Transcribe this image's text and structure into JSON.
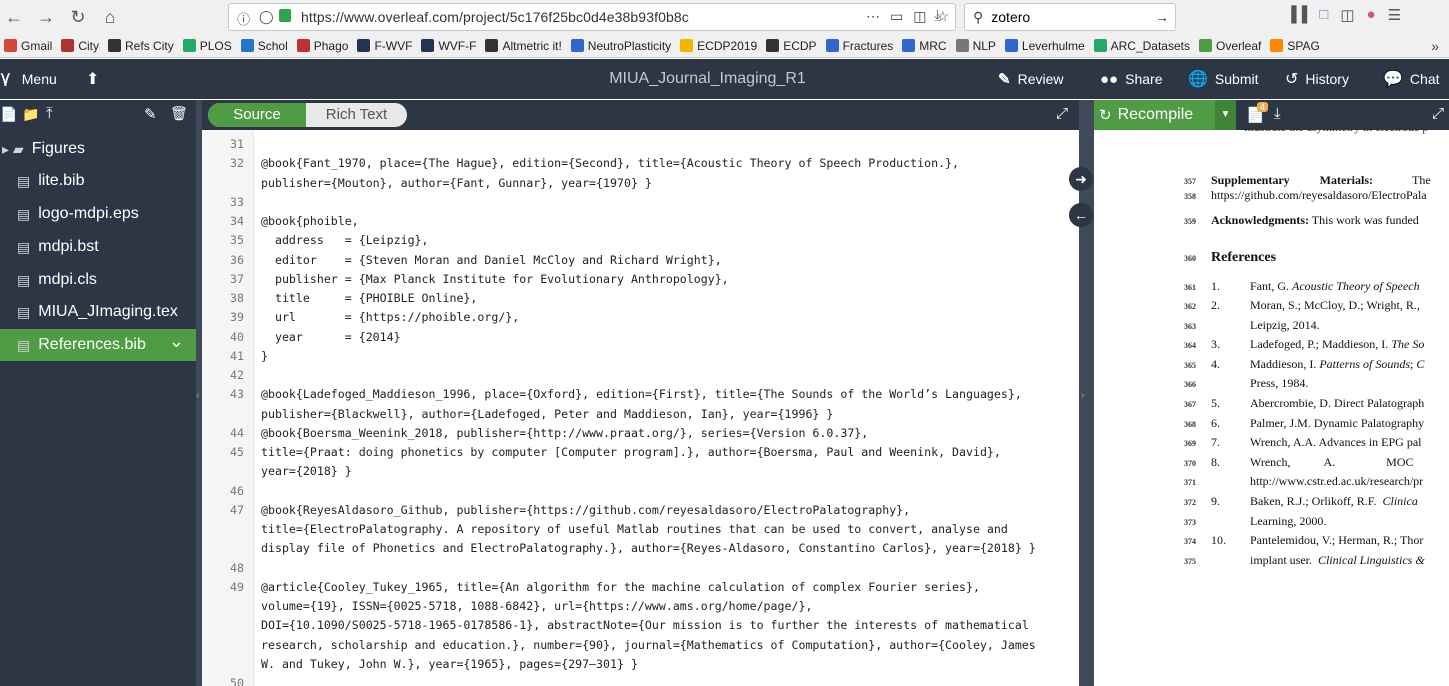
{
  "browser": {
    "url": "https://www.overleaf.com/project/5c176f25bc0d4e38b93f0b8c",
    "search": "zotero",
    "bookmarks": [
      "Gmail",
      "City",
      "Refs City",
      "PLOS",
      "Schol",
      "Phago",
      "F-WVF",
      "WVF-F",
      "Altmetric it!",
      "NeutroPlasticity",
      "ECDP2019",
      "ECDP",
      "Fractures",
      "MRC",
      "NLP",
      "Leverhulme",
      "ARC_Datasets",
      "Overleaf",
      "SPAG"
    ]
  },
  "header": {
    "menu": "Menu",
    "project_title": "MIUA_Journal_Imaging_R1",
    "review": "Review",
    "share": "Share",
    "submit": "Submit",
    "history": "History",
    "chat": "Chat"
  },
  "editor": {
    "source": "Source",
    "rich_text": "Rich Text",
    "recompile": "Recompile",
    "log_badge": "4"
  },
  "files": [
    "Figures",
    "lite.bib",
    "logo-mdpi.eps",
    "mdpi.bst",
    "mdpi.cls",
    "MIUA_JImaging.tex",
    "References.bib"
  ],
  "code": [
    {
      "n": "31",
      "t": ""
    },
    {
      "n": "32",
      "t": "@book{Fant_1970, place={The Hague}, edition={Second}, title={Acoustic Theory of Speech Production.},"
    },
    {
      "n": "",
      "t": "publisher={Mouton}, author={Fant, Gunnar}, year={1970} }"
    },
    {
      "n": "33",
      "t": ""
    },
    {
      "n": "34",
      "t": "@book{phoible,"
    },
    {
      "n": "35",
      "t": "  address   = {Leipzig},"
    },
    {
      "n": "36",
      "t": "  editor    = {Steven Moran and Daniel McCloy and Richard Wright},"
    },
    {
      "n": "37",
      "t": "  publisher = {Max Planck Institute for Evolutionary Anthropology},"
    },
    {
      "n": "38",
      "t": "  title     = {PHOIBLE Online},"
    },
    {
      "n": "39",
      "t": "  url       = {https://phoible.org/},"
    },
    {
      "n": "40",
      "t": "  year      = {2014}"
    },
    {
      "n": "41",
      "t": "}"
    },
    {
      "n": "42",
      "t": ""
    },
    {
      "n": "43",
      "t": "@book{Ladefoged_Maddieson_1996, place={Oxford}, edition={First}, title={The Sounds of the World’s Languages},"
    },
    {
      "n": "",
      "t": "publisher={Blackwell}, author={Ladefoged, Peter and Maddieson, Ian}, year={1996} }"
    },
    {
      "n": "44",
      "t": "@book{Boersma_Weenink_2018, publisher={http://www.praat.org/}, series={Version 6.0.37},"
    },
    {
      "n": "45",
      "t": "title={Praat: doing phonetics by computer [Computer program].}, author={Boersma, Paul and Weenink, David},"
    },
    {
      "n": "",
      "t": "year={2018} }"
    },
    {
      "n": "46",
      "t": ""
    },
    {
      "n": "47",
      "t": "@book{ReyesAldasoro_Github, publisher={https://github.com/reyesaldasoro/ElectroPalatography},"
    },
    {
      "n": "",
      "t": "title={ElectroPalatography. A repository of useful Matlab routines that can be used to convert, analyse and"
    },
    {
      "n": "",
      "t": "display file of Phonetics and ElectroPalatography.}, author={Reyes-Aldasoro, Constantino Carlos}, year={2018} }"
    },
    {
      "n": "48",
      "t": ""
    },
    {
      "n": "49",
      "t": "@article{Cooley_Tukey_1965, title={An algorithm for the machine calculation of complex Fourier series},"
    },
    {
      "n": "",
      "t": "volume={19}, ISSN={0025-5718, 1088-6842}, url={https://www.ams.org/home/page/},"
    },
    {
      "n": "",
      "t": "DOI={10.1090/S0025-5718-1965-0178586-1}, abstractNote={Our mission is to further the interests of mathematical"
    },
    {
      "n": "",
      "t": "research, scholarship and education.}, number={90}, journal={Mathematics of Computation}, author={Cooley, James"
    },
    {
      "n": "",
      "t": "W. and Tukey, John W.}, year={1965}, pages={297–301} }"
    },
    {
      "n": "50",
      "t": ""
    }
  ],
  "pdf": {
    "top_cut": "illustrate the asymmetry in electrode p",
    "lines": [
      {
        "n": "357",
        "t": "<b>Supplementary&nbsp;&nbsp;&nbsp;&nbsp;&nbsp;&nbsp;&nbsp;&nbsp;&nbsp;&nbsp;Materials:</b>&nbsp;&nbsp;&nbsp;&nbsp;&nbsp;&nbsp;&nbsp;&nbsp;&nbsp;&nbsp;&nbsp;&nbsp;&nbsp;The"
      },
      {
        "n": "358",
        "t": "https://github.com/reyesaldasoro/ElectroPala"
      },
      {
        "n": "359",
        "t": "<b>Acknowledgments:</b> This work was funded"
      },
      {
        "n": "360",
        "t": "<b style=\"font-size:14px\">References</b>"
      },
      {
        "n": "361",
        "t": "1.&nbsp;&nbsp;&nbsp;&nbsp;&nbsp;&nbsp;&nbsp;&nbsp;&nbsp;&nbsp;Fant, G. <i>Acoustic Theory of Speech</i>"
      },
      {
        "n": "362",
        "t": "2.&nbsp;&nbsp;&nbsp;&nbsp;&nbsp;&nbsp;&nbsp;&nbsp;&nbsp;&nbsp;Moran, S.; McCloy, D.; Wright, R.,"
      },
      {
        "n": "363",
        "t": "&nbsp;&nbsp;&nbsp;&nbsp;&nbsp;&nbsp;&nbsp;&nbsp;&nbsp;&nbsp;&nbsp;&nbsp;&nbsp;Leipzig, 2014."
      },
      {
        "n": "364",
        "t": "3.&nbsp;&nbsp;&nbsp;&nbsp;&nbsp;&nbsp;&nbsp;&nbsp;&nbsp;&nbsp;Ladefoged, P.; Maddieson, I. <i>The So</i>"
      },
      {
        "n": "365",
        "t": "4.&nbsp;&nbsp;&nbsp;&nbsp;&nbsp;&nbsp;&nbsp;&nbsp;&nbsp;&nbsp;Maddieson, I. <i>Patterns of Sounds</i>; <i>C</i>"
      },
      {
        "n": "366",
        "t": "&nbsp;&nbsp;&nbsp;&nbsp;&nbsp;&nbsp;&nbsp;&nbsp;&nbsp;&nbsp;&nbsp;&nbsp;&nbsp;Press, 1984."
      },
      {
        "n": "367",
        "t": "5.&nbsp;&nbsp;&nbsp;&nbsp;&nbsp;&nbsp;&nbsp;&nbsp;&nbsp;&nbsp;Abercrombie, D. Direct Palatograph"
      },
      {
        "n": "368",
        "t": "6.&nbsp;&nbsp;&nbsp;&nbsp;&nbsp;&nbsp;&nbsp;&nbsp;&nbsp;&nbsp;Palmer, J.M. Dynamic Palatography"
      },
      {
        "n": "369",
        "t": "7.&nbsp;&nbsp;&nbsp;&nbsp;&nbsp;&nbsp;&nbsp;&nbsp;&nbsp;&nbsp;Wrench, A.A. Advances in EPG pal"
      },
      {
        "n": "370",
        "t": "8.&nbsp;&nbsp;&nbsp;&nbsp;&nbsp;&nbsp;&nbsp;&nbsp;&nbsp;&nbsp;Wrench,&nbsp;&nbsp;&nbsp;&nbsp;&nbsp;&nbsp;&nbsp;&nbsp;&nbsp;&nbsp;&nbsp;A.&nbsp;&nbsp;&nbsp;&nbsp;&nbsp;&nbsp;&nbsp;&nbsp;&nbsp;&nbsp;&nbsp;&nbsp;&nbsp;&nbsp;&nbsp;&nbsp;&nbsp;MOC"
      },
      {
        "n": "371",
        "t": "&nbsp;&nbsp;&nbsp;&nbsp;&nbsp;&nbsp;&nbsp;&nbsp;&nbsp;&nbsp;&nbsp;&nbsp;&nbsp;http://www.cstr.ed.ac.uk/research/pr"
      },
      {
        "n": "372",
        "t": "9.&nbsp;&nbsp;&nbsp;&nbsp;&nbsp;&nbsp;&nbsp;&nbsp;&nbsp;&nbsp;Baken, R.J.; Orlikoff, R.F.&nbsp;&nbsp;<i>Clinica</i>"
      },
      {
        "n": "373",
        "t": "&nbsp;&nbsp;&nbsp;&nbsp;&nbsp;&nbsp;&nbsp;&nbsp;&nbsp;&nbsp;&nbsp;&nbsp;&nbsp;Learning, 2000."
      },
      {
        "n": "374",
        "t": "10.&nbsp;&nbsp;&nbsp;&nbsp;&nbsp;&nbsp;&nbsp;&nbsp;Pantelemidou, V.; Herman, R.; Thor"
      },
      {
        "n": "375",
        "t": "&nbsp;&nbsp;&nbsp;&nbsp;&nbsp;&nbsp;&nbsp;&nbsp;&nbsp;&nbsp;&nbsp;&nbsp;&nbsp;implant user.&nbsp;&nbsp;<i>Clinical Linguistics &amp;</i>"
      }
    ]
  },
  "colors": {
    "accent": "#4f9c45",
    "panel": "#2c3645"
  }
}
